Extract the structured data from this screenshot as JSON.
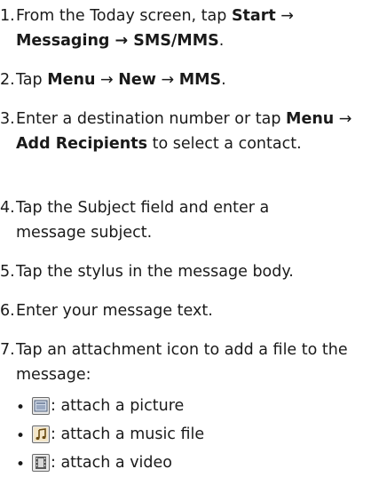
{
  "steps": [
    {
      "num": "1.",
      "parts": [
        {
          "t": "From the Today screen, tap ",
          "b": false
        },
        {
          "t": "Start",
          "b": true
        },
        {
          "t": " → ",
          "b": false
        },
        {
          "t": "Messaging",
          "b": true
        },
        {
          "t": " → ",
          "b": true
        },
        {
          "t": "SMS/MMS",
          "b": true
        },
        {
          "t": ".",
          "b": false
        }
      ]
    },
    {
      "num": "2.",
      "parts": [
        {
          "t": "Tap ",
          "b": false
        },
        {
          "t": "Menu",
          "b": true
        },
        {
          "t": " → ",
          "b": false
        },
        {
          "t": "New",
          "b": true
        },
        {
          "t": " → ",
          "b": false
        },
        {
          "t": "MMS",
          "b": true
        },
        {
          "t": ".",
          "b": false
        }
      ]
    },
    {
      "num": "3.",
      "parts": [
        {
          "t": "Enter a destination number or tap ",
          "b": false
        },
        {
          "t": "Menu",
          "b": true
        },
        {
          "t": " → ",
          "b": false
        },
        {
          "t": "Add Recipients",
          "b": true
        },
        {
          "t": " to select a contact.",
          "b": false
        }
      ]
    },
    {
      "num": "4.",
      "parts": [
        {
          "t": "Tap the Subject field and enter a message subject.",
          "b": false
        }
      ]
    },
    {
      "num": "5.",
      "parts": [
        {
          "t": "Tap the stylus in the message body.",
          "b": false
        }
      ]
    },
    {
      "num": "6.",
      "parts": [
        {
          "t": "Enter your message text.",
          "b": false
        }
      ]
    },
    {
      "num": "7.",
      "parts": [
        {
          "t": "Tap an attachment icon to add a file to the message:",
          "b": false
        }
      ]
    }
  ],
  "attachments": [
    {
      "bullet": "•",
      "icon": "picture-attach-icon",
      "text": ": attach a picture"
    },
    {
      "bullet": "•",
      "icon": "music-attach-icon",
      "text": ": attach a music file"
    },
    {
      "bullet": "•",
      "icon": "video-attach-icon",
      "text": ": attach a video"
    }
  ]
}
